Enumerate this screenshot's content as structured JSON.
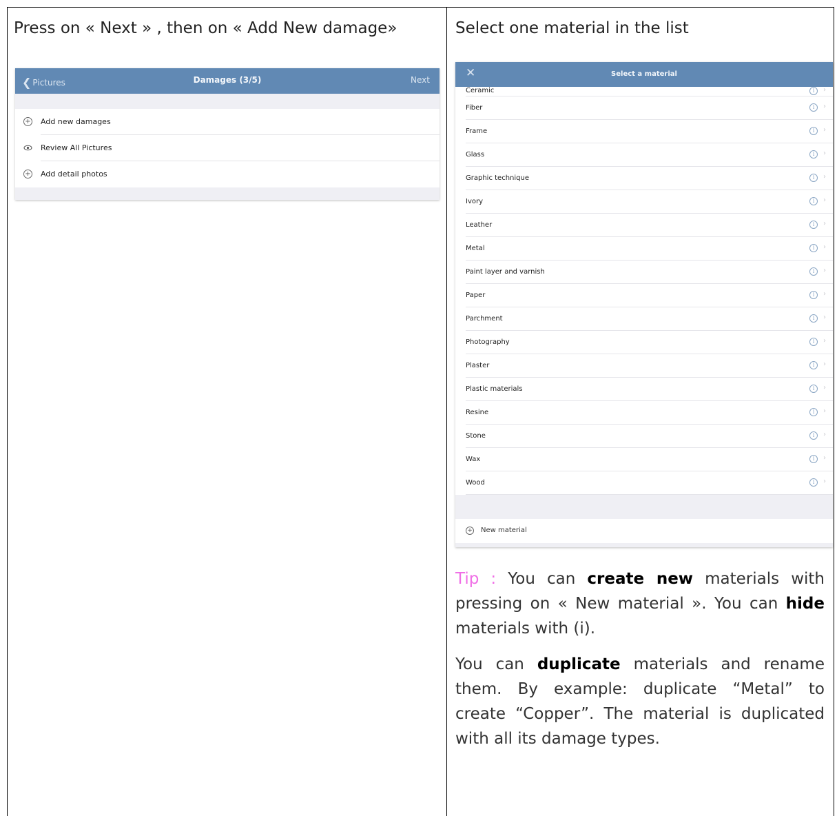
{
  "left_cell": {
    "heading": "Press on « Next » , then on « Add New damage»",
    "nav": {
      "back_label": "Pictures",
      "title": "Damages (3/5)",
      "next_label": "Next"
    },
    "rows": [
      {
        "icon": "add-circle-icon",
        "label": "Add new damages"
      },
      {
        "icon": "eye-icon",
        "label": "Review All Pictures"
      },
      {
        "icon": "add-circle-icon",
        "label": "Add detail photos"
      }
    ]
  },
  "right_cell": {
    "heading": "Select one material in the list",
    "nav": {
      "title": "Select a material"
    },
    "materials": [
      "Ceramic",
      "Fiber",
      "Frame",
      "Glass",
      "Graphic technique",
      "Ivory",
      "Leather",
      "Metal",
      "Paint layer and varnish",
      "Paper",
      "Parchment",
      "Photography",
      "Plaster",
      "Plastic materials",
      "Resine",
      "Stone",
      "Wax",
      "Wood"
    ],
    "new_material_label": "New material",
    "tip": {
      "label": "Tip :",
      "p1_a": " You can ",
      "p1_b": "create new",
      "p1_c": " materials with pressing on « New material ». You can ",
      "p1_d": "hide",
      "p1_e": " materials with (i).",
      "p2_a": "You can ",
      "p2_b": "duplicate",
      "p2_c": " materials and rename them. By example: duplicate “Metal” to create “Copper”. The material is duplicated with all its damage types."
    }
  },
  "colors": {
    "nav_bar": "#6189b4",
    "tip_label": "#f06ee6",
    "list_background": "#efeff4"
  }
}
